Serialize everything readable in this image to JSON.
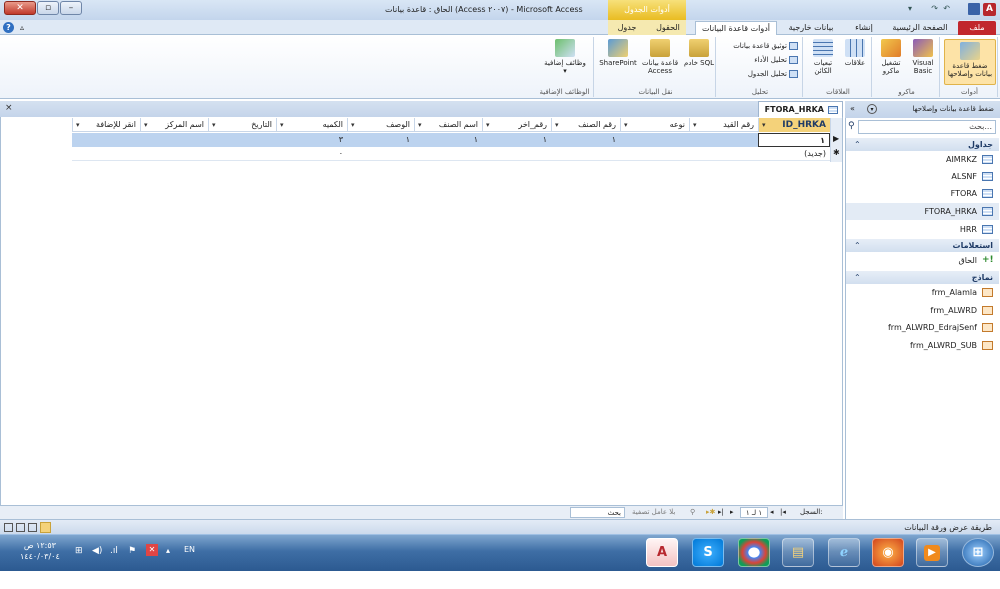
{
  "window": {
    "title": "الحاق : قاعدة بيانات (Access ٢٠٠٧) - Microsoft Access",
    "context_tab_header": "أدوات الجدول",
    "qat_items": [
      "↶",
      "↷",
      "▾"
    ]
  },
  "ribbon_tabs": [
    {
      "label": "ملف"
    },
    {
      "label": "الصفحة الرئيسية"
    },
    {
      "label": "إنشاء"
    },
    {
      "label": "بيانات خارجية"
    },
    {
      "label": "أدوات قاعدة البيانات"
    },
    {
      "label": "الحقول"
    },
    {
      "label": "جدول"
    }
  ],
  "ribbon": {
    "groups": [
      {
        "label": "أدوات",
        "buttons": [
          "ضغط قاعدة بيانات وإصلاحها"
        ]
      },
      {
        "label": "ماكرو",
        "buttons": [
          "Visual Basic",
          "تشغيل ماكرو"
        ]
      },
      {
        "label": "العلاقات",
        "buttons": [
          "علاقات",
          "تبعيات الكائن"
        ]
      },
      {
        "label": "تحليل",
        "buttons": [
          "توثيق قاعدة بيانات",
          "تحليل الأداء",
          "تحليل الجدول"
        ]
      },
      {
        "label": "نقل البيانات",
        "buttons": [
          "خادم SQL",
          "قاعدة بيانات Access",
          "SharePoint"
        ]
      },
      {
        "label": "الوظائف الإضافية",
        "buttons": [
          "وظائف إضافية ▾"
        ]
      }
    ]
  },
  "document": {
    "tab_title": "FTORA_HRKA",
    "close_glyph": "×",
    "columns": [
      "ID_HRKA",
      "رقم القيد",
      "نوعه",
      "رقم الصنف",
      "رقم_اخر",
      "اسم الصنف",
      "الوصف",
      "الكميه",
      "التاريخ",
      "اسم المركز",
      "انقر للإضافة"
    ],
    "rows": [
      [
        "١",
        "",
        "",
        "١",
        "١",
        "١",
        "١",
        "٣",
        "",
        "",
        ""
      ]
    ],
    "new_row_label": "(جديد)",
    "new_row_value": "٠",
    "record_selector_current": "▶",
    "record_selector_new": "✱"
  },
  "record_nav": {
    "label": "السجل:",
    "position": "١ لـ ١",
    "filter_label": "بلا عامل تصفية",
    "search_label": "بحث"
  },
  "nav_pane": {
    "title": "ضغط قاعدة بيانات وإصلاحها",
    "search_placeholder": "بحث...",
    "sections": [
      {
        "label": "جداول",
        "items": [
          "AIMRKZ",
          "ALSNF",
          "FTORA",
          "FTORA_HRKA",
          "HRR"
        ]
      },
      {
        "label": "استعلامات",
        "items": [
          "الحاق"
        ]
      },
      {
        "label": "نماذج",
        "items": [
          "frm_Alamla",
          "frm_ALWRD",
          "frm_ALWRD_EdrajSenf",
          "frm_ALWRD_SUB"
        ]
      }
    ]
  },
  "status_bar": {
    "left_text": "طريقة عرض ورقة البيانات"
  },
  "taskbar": {
    "clock_time": "١٢:٥٣ ص",
    "clock_date": "١٤٤٠/٠٣/٠٤",
    "language": "EN",
    "apps": [
      "start",
      "firefox",
      "media",
      "ie",
      "explorer",
      "chrome",
      "skype",
      "access"
    ]
  }
}
